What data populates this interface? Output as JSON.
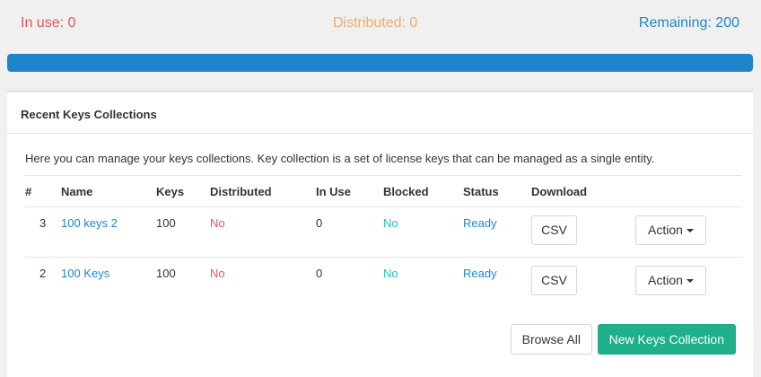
{
  "stats": {
    "in_use": "In use: 0",
    "distributed": "Distributed: 0",
    "remaining": "Remaining: 200"
  },
  "progress": {
    "remaining_fraction": 1.0,
    "color": "#1e84cc"
  },
  "panel": {
    "title": "Recent Keys Collections",
    "intro": "Here you can manage your keys collections. Key collection is a set of license keys that can be managed as a single entity."
  },
  "table": {
    "headers": [
      "#",
      "Name",
      "Keys",
      "Distributed",
      "In Use",
      "Blocked",
      "Status",
      "Download",
      ""
    ],
    "rows": [
      {
        "num": "3",
        "name": "100 keys 2",
        "keys": "100",
        "distributed": "No",
        "in_use": "0",
        "blocked": "No",
        "status": "Ready",
        "download": "CSV",
        "action": "Action"
      },
      {
        "num": "2",
        "name": "100 Keys",
        "keys": "100",
        "distributed": "No",
        "in_use": "0",
        "blocked": "No",
        "status": "Ready",
        "download": "CSV",
        "action": "Action"
      }
    ]
  },
  "footer": {
    "browse_all": "Browse All",
    "new_collection": "New Keys Collection"
  },
  "colors": {
    "in_use": "#e8505b",
    "distributed": "#f0ad68",
    "remaining": "#1e88cf",
    "primary_button": "#1faf8a"
  }
}
